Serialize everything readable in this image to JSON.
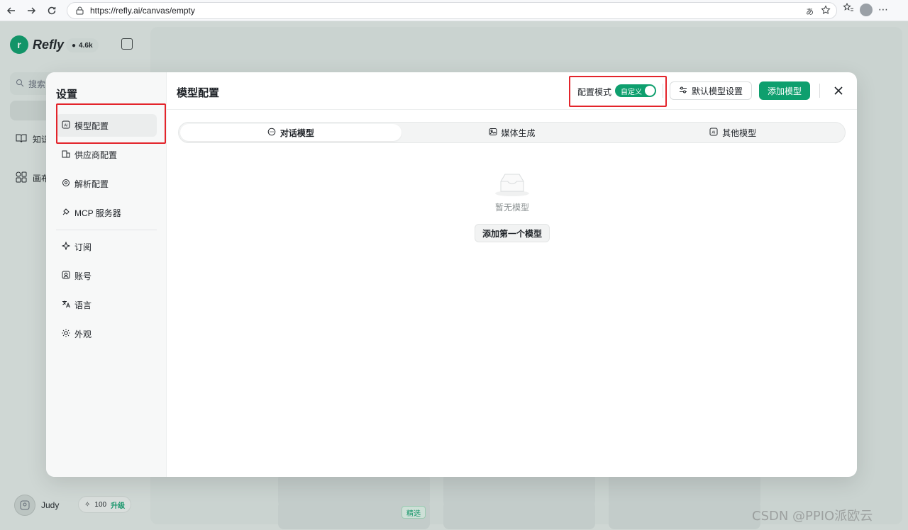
{
  "browser": {
    "url": "https://refly.ai/canvas/empty"
  },
  "app": {
    "logo_text": "Refly",
    "github_stars": "4.6k",
    "search_placeholder": "搜索",
    "side_links": [
      "知识",
      "画布"
    ],
    "user_name": "Judy",
    "credits": "100",
    "upgrade_label": "升级",
    "featured_tag": "精选"
  },
  "settings": {
    "title": "设置",
    "menu": [
      {
        "label": "模型配置",
        "icon": "ai-chip-icon",
        "active": true
      },
      {
        "label": "供应商配置",
        "icon": "building-icon",
        "active": false
      },
      {
        "label": "解析配置",
        "icon": "gear-icon",
        "active": false
      },
      {
        "label": "MCP 服务器",
        "icon": "plug-icon",
        "active": false
      },
      {
        "label": "订阅",
        "icon": "sparkle-icon",
        "active": false
      },
      {
        "label": "账号",
        "icon": "user-badge-icon",
        "active": false
      },
      {
        "label": "语言",
        "icon": "translate-icon",
        "active": false
      },
      {
        "label": "外观",
        "icon": "sun-icon",
        "active": false
      }
    ]
  },
  "model_config": {
    "title": "模型配置",
    "mode_label": "配置模式",
    "mode_value": "自定义",
    "default_settings_label": "默认模型设置",
    "add_model_label": "添加模型",
    "tabs": [
      {
        "label": "对话模型",
        "icon": "chat-bubble-icon",
        "active": true
      },
      {
        "label": "媒体生成",
        "icon": "image-icon",
        "active": false
      },
      {
        "label": "其他模型",
        "icon": "ai-chip-icon",
        "active": false
      }
    ],
    "empty_text": "暂无模型",
    "add_first_label": "添加第一个模型"
  },
  "accent_color": "#0e9f6e",
  "highlight_color": "#e3242b",
  "watermark": "CSDN @PPIO派欧云"
}
